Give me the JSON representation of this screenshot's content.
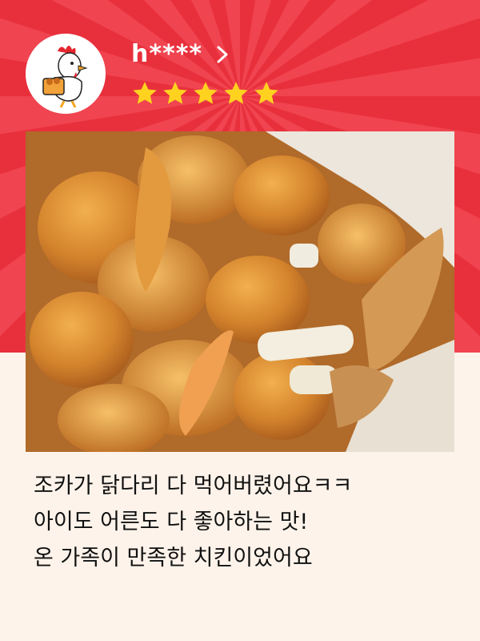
{
  "user": {
    "name": "h****",
    "rating": 5,
    "avatar_icon": "chicken-mascot-icon"
  },
  "review": {
    "lines": [
      "조카가 닭다리 다 먹어버렸어요ㅋㅋ",
      "아이도 어른도 다 좋아하는 맛!",
      "온 가족이 만족한 치킨이었어요"
    ]
  },
  "colors": {
    "header_red": "#e8303c",
    "star": "#ffd21f",
    "background": "#fdf3ea"
  }
}
